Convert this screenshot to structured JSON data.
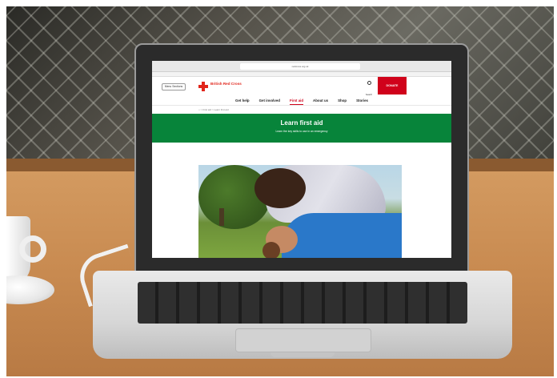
{
  "browser": {
    "url": "redcross.org.uk"
  },
  "site": {
    "menu_label": "Menu  Sections",
    "logo_text": "British Red Cross",
    "search_label": "Search",
    "donate_label": "DONATE"
  },
  "nav": {
    "items": [
      {
        "label": "Get help"
      },
      {
        "label": "Get involved"
      },
      {
        "label": "First aid",
        "active": true
      },
      {
        "label": "About us"
      },
      {
        "label": "Shop"
      },
      {
        "label": "Stories"
      }
    ]
  },
  "breadcrumb": "⌂ > First aid > Learn first aid",
  "hero": {
    "title": "Learn first aid",
    "subtitle": "Learn the key skills to use in an emergency"
  },
  "colors": {
    "hero_green": "#07843a",
    "brand_red": "#d0021b"
  }
}
